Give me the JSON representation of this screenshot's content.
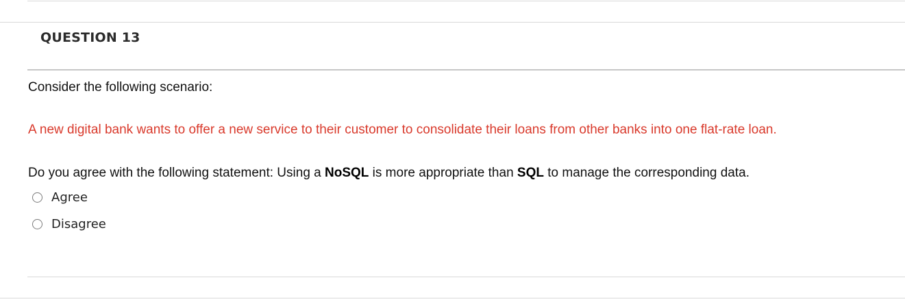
{
  "question": {
    "title": "QUESTION 13",
    "scenario_intro": "Consider the following scenario:",
    "scenario_body": "A new digital bank wants to offer a new service to their customer to consolidate their loans from other banks into one flat-rate loan.",
    "statement": {
      "prefix": "Do you agree with the following statement: Using a ",
      "term1": "NoSQL",
      "middle": " is more appropriate than ",
      "term2": "SQL",
      "suffix": " to manage the corresponding data."
    },
    "options": [
      {
        "label": "Agree",
        "selected": false
      },
      {
        "label": "Disagree",
        "selected": false
      }
    ]
  },
  "colors": {
    "scenario_text": "#d9392b",
    "body_text": "#111111"
  }
}
